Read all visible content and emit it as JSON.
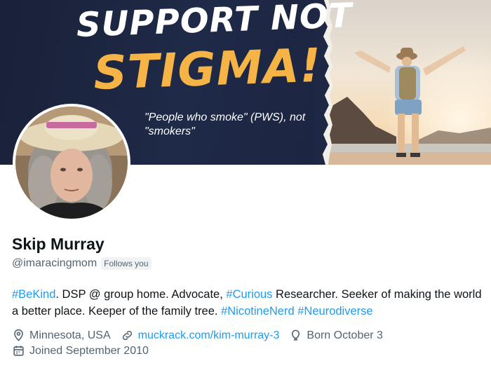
{
  "banner": {
    "headline_line1": "SUPPORT NOT",
    "headline_line2": "STIGMA!",
    "subtext": "\"People who smoke\" (PWS), not \"smokers\"",
    "colors": {
      "navy": "#1d2540",
      "orange": "#f6b447"
    }
  },
  "profile": {
    "display_name": "Skip Murray",
    "handle": "@imaracingmom",
    "follows_you_label": "Follows you",
    "bio": {
      "tag_bekind": "#BeKind",
      "text1": ". DSP @ group home. Advocate, ",
      "tag_curious": "#Curious",
      "text2": " Researcher. Seeker of making the world a better place. Keeper of the family tree. ",
      "tag_nicotinenerd": "#NicotineNerd",
      "text3": " ",
      "tag_neurodiverse": "#Neurodiverse"
    },
    "location": "Minnesota, USA",
    "website": "muckrack.com/kim-murray-3",
    "birthday": "Born October 3",
    "joined": "Joined September 2010"
  },
  "icons": {
    "location": "location-pin-icon",
    "website": "link-icon",
    "birthday": "balloon-icon",
    "joined": "calendar-icon"
  },
  "colors": {
    "link": "#1d9bf0",
    "secondary_text": "#536471",
    "primary_text": "#0f1419"
  }
}
